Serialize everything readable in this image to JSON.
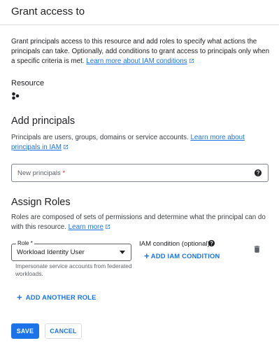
{
  "header": {
    "title": "Grant access to"
  },
  "intro": {
    "text": "Grant principals access to this resource and add roles to specify what actions the principals can take. Optionally, add conditions to grant access to principals only when a specific criteria is met. ",
    "link": "Learn more about IAM conditions"
  },
  "resource": {
    "label": "Resource",
    "icon": "resource-dots-icon"
  },
  "principals": {
    "heading": "Add principals",
    "description": "Principals are users, groups, domains or service accounts. ",
    "link": "Learn more about principals in IAM",
    "input": {
      "placeholder": "New principals",
      "required_mark": "*",
      "value": ""
    }
  },
  "roles": {
    "heading": "Assign Roles",
    "description": "Roles are composed of sets of permissions and determine what the principal can do with this resource. ",
    "link": "Learn more",
    "role_select": {
      "label": "Role *",
      "value": "Workload Identity User",
      "help": "Impersonate service accounts from federated workloads."
    },
    "condition": {
      "label": "IAM condition (optional)",
      "add_label": "ADD IAM CONDITION"
    },
    "add_another_label": "ADD ANOTHER ROLE"
  },
  "actions": {
    "save_label": "SAVE",
    "cancel_label": "CANCEL"
  },
  "colors": {
    "accent": "#1a73e8",
    "text": "#202124",
    "muted": "#5f6368",
    "divider": "#dadce0"
  }
}
